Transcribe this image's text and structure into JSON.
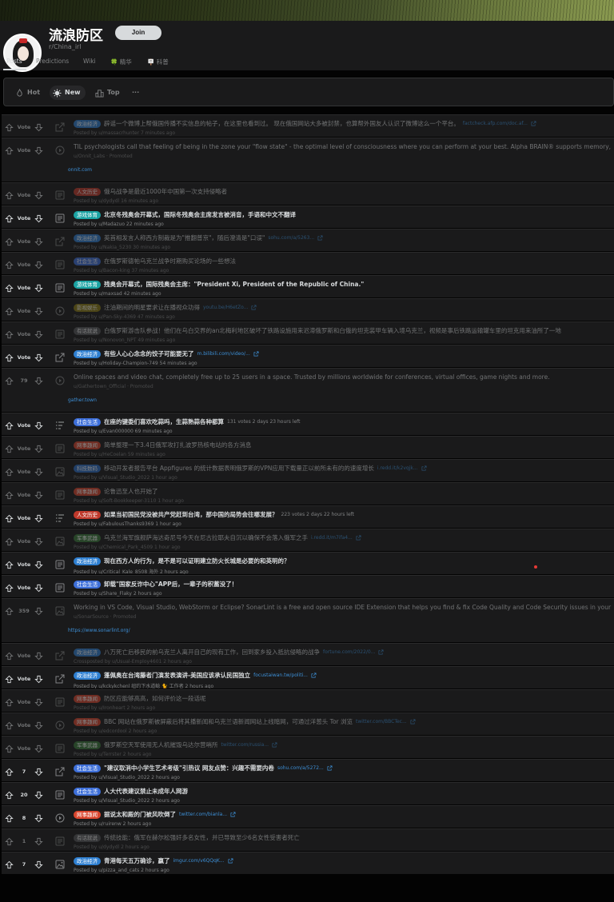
{
  "subreddit": {
    "title": "流浪防区",
    "name": "r/China_irl",
    "join_label": "Join"
  },
  "nav": [
    {
      "label": "Posts",
      "active": true
    },
    {
      "label": "Predictions",
      "active": false
    },
    {
      "label": "Wiki",
      "active": false
    },
    {
      "label": "🍀 精华",
      "active": false
    },
    {
      "label": "🪧 科普",
      "active": false
    }
  ],
  "sort": {
    "hot_label": "Hot",
    "new_label": "New",
    "top_label": "Top",
    "more_label": "···"
  },
  "colors": {
    "政治经济": "#2e7fd1",
    "人文历史": "#c0392b",
    "游戏体育": "#1aa3a3",
    "社会生活": "#3d6fd9",
    "影视娱乐": "#8a7a14",
    "有话就说": "#555759",
    "网事趣闻": "#d9462e",
    "科技数码": "#2a6cc4",
    "军事武器": "#3a7a3a"
  },
  "posts": [
    {
      "score": "Vote",
      "kind": "link",
      "flair": "政治经济",
      "title": "辟谣一个微博上帮俄国传播不实信息的帖子，在这里也看到过。 现在俄国网站大多被封禁，也算帮外国友人认识了微博这么一个平台。",
      "link": "factcheck.afp.com/doc.af...",
      "meta": "Posted by u/massacrhunter 7 minutes ago",
      "dim": true
    },
    {
      "score": "Vote",
      "kind": "video",
      "flair": "",
      "title": "TIL psychologists call that feeling of being in the zone your \"flow state\" - the optimal level of consciousness where you can perform at your best. Alpha BRAIN® supports memory,",
      "link": "",
      "meta": "u/Onnit_Labs · Promoted",
      "dim": true,
      "ad": "onnit.com"
    },
    {
      "score": "Vote",
      "kind": "text",
      "flair": "人文历史",
      "title": "俄乌战争是最近1000年中国第一次支持侵略者",
      "link": "",
      "meta": "Posted by u/dydydl 16 minutes ago",
      "dim": true
    },
    {
      "score": "Vote",
      "kind": "text",
      "flair": "游戏体育",
      "title": "北京冬残奥会开幕式，国际冬残奥会主席发言被消音，手语和中文不翻译",
      "link": "",
      "meta": "Posted by u/Madazuo 22 minutes ago",
      "dim": false
    },
    {
      "score": "Vote",
      "kind": "link",
      "flair": "政治经济",
      "title": "英首相发言人称西方制裁是为\"推翻普京\"，随后澄清是\"口误\"",
      "link": "sohu.com/a/5263...",
      "meta": "Posted by u/Nakia_5230 30 minutes ago",
      "dim": true
    },
    {
      "score": "Vote",
      "kind": "text",
      "flair": "社会生活",
      "title": "在俄罗斯德帕乌克兰战争时期购买论场的一些想法",
      "link": "",
      "meta": "Posted by u/Bacon-king 37 minutes ago",
      "dim": true
    },
    {
      "score": "Vote",
      "kind": "text",
      "flair": "游戏体育",
      "title": "残奥会开幕式，国际残奥会主席：\"President Xi, President of the Republic of China.\"",
      "link": "",
      "meta": "Posted by u/maxsad 42 minutes ago",
      "dim": false
    },
    {
      "score": "Vote",
      "kind": "video",
      "flair": "影视娱乐",
      "title": "注油期间的明星要求让在播视众功得",
      "link": "youtu.be/H6etZo...",
      "meta": "Posted by u/Pan-Sky-4369 47 minutes ago",
      "dim": true
    },
    {
      "score": "Vote",
      "kind": "text",
      "flair": "有话就说",
      "title": "白俄罗斯游击队参战！他们在乌白交界的an北梅利地区破坏了铁路设施用来迟滞俄罗斯和白俄的坦克装甲车辆入境乌克兰，视频是事后铁路运输罐车里的坦克用来油所了一地",
      "link": "",
      "meta": "Posted by u/Nonovon_NPT 49 minutes ago",
      "dim": true
    },
    {
      "score": "Vote",
      "kind": "link",
      "flair": "政治经济",
      "title": "有些人心心念念的饺子可能要无了",
      "link": "m.bilibili.com/video/...",
      "meta": "Posted by u/Holiday-Champion-749 54 minutes ago",
      "dim": false
    },
    {
      "score": "79",
      "kind": "video",
      "flair": "",
      "title": "Online spaces and video chat, completely free up to 25 users in a space. Trusted by millions worldwide for conferences, virtual offices, game nights and more.",
      "link": "",
      "meta": "u/Gathertown_Official · Promoted",
      "dim": true,
      "ad": "gather.town"
    },
    {
      "score": "Vote",
      "kind": "poll",
      "flair": "社会生活",
      "title": "在座的键委们喜欢吃蒜吗，生蒜熟蒜各种都算",
      "link": "",
      "poll": "131 votes 2 days 23 hours left",
      "meta": "Posted by u/Evan000000 69 minutes ago",
      "dim": false
    },
    {
      "score": "Vote",
      "kind": "text",
      "flair": "网事趣闻",
      "title": "简单整理一下3.4日俄军攻打扎波罗热核电站的各方消息",
      "link": "",
      "meta": "Posted by u/HeCoelan 59 minutes ago",
      "dim": true
    },
    {
      "score": "Vote",
      "kind": "image",
      "flair": "科技数码",
      "title": "移动开发者报告平台 Appfigures 的统计数据表明俄罗斯的VPN应用下载量正以前所未有的的速度增长",
      "link": "i.redd.it/k2vqjk...",
      "meta": "Posted by u/Visual_Studio_2022 1 hour ago",
      "dim": true
    },
    {
      "score": "Vote",
      "kind": "text",
      "flair": "网事趣闻",
      "title": "论鲁迅至人也开始了",
      "link": "",
      "meta": "Posted by u/Soft-Bookkeeper-3110 1 hour ago",
      "dim": true
    },
    {
      "score": "Vote",
      "kind": "poll",
      "flair": "人文历史",
      "title": "如果当初国民党没被共产党赶到台湾，那中国的局势会往哪发展？",
      "link": "",
      "poll": "223 votes 2 days 22 hours left",
      "meta": "Posted by u/FabulousThanks9369 1 hour ago",
      "dim": false
    },
    {
      "score": "Vote",
      "kind": "image",
      "flair": "军事武器",
      "title": "乌克兰海军旗舰萨海达奇尼号今天在尼古拉耶夫自沉以确保不会落入俄军之手",
      "link": "i.redd.it/m7ifa4...",
      "meta": "Posted by u/Chemical_Park_4509 1 hour ago",
      "dim": true
    },
    {
      "score": "Vote",
      "kind": "text",
      "flair": "政治经济",
      "title": "现在西方人的行为，是不是可以证明建立防火长城是必要的和英明的？",
      "link": "",
      "meta": "Posted by u/Critical_Kale_8508 海外 2 hours ago",
      "dim": false
    },
    {
      "score": "Vote",
      "kind": "text",
      "flair": "社会生活",
      "title": "卸载\"国家反诈中心\"APP后，一辈子的积蓄没了！",
      "link": "",
      "meta": "Posted by u/Share_Flaky 2 hours ago",
      "dim": false
    },
    {
      "score": "359",
      "kind": "image",
      "flair": "",
      "title": "Working in VS Code, Visual Studio, WebStorm or Eclipse? SonarLint is a free and open source IDE Extension that helps you find & fix Code Quality and Code Security issues in your",
      "link": "",
      "meta": "u/SonarSource · Promoted",
      "dim": true,
      "ad": "https://www.sonarlint.org/"
    },
    {
      "score": "Vote",
      "kind": "link",
      "flair": "政治经济",
      "title": "八万死亡后移民的前乌克兰人离开自己的现有工作，回到家乡投入抵抗侵略的战争",
      "link": "fortune.com/2022/0...",
      "meta": "Crossposted by u/Usual-Employ4601 2 hours ago",
      "dim": true
    },
    {
      "score": "Vote",
      "kind": "link",
      "flair": "政治经济",
      "title": "蓬佩奥在台湾藤者门演发表演讲-美国应该承认民国独立",
      "link": "focustaiwan.tw/politi...",
      "meta": "Posted by u/kckykchenl 纽约下水道鲶 🐈 工作者 2 hours ago",
      "dim": false
    },
    {
      "score": "Vote",
      "kind": "text",
      "flair": "网事趣闻",
      "title": "防区应能够高高，如何评价这一段话呢",
      "link": "",
      "meta": "Posted by u/Ironheart 2 hours ago",
      "dim": true
    },
    {
      "score": "Vote",
      "kind": "video",
      "flair": "网事趣闻",
      "title": "BBC 网站在俄罗斯被屏蔽后将其播新闻和乌克兰语新闻网站上线暗网，可通过洋葱头 Tor 浏览",
      "link": "twitter.com/BBCTec...",
      "meta": "Posted by u/edcordool 2 hours ago",
      "dim": true
    },
    {
      "score": "Vote",
      "kind": "text",
      "flair": "军事武器",
      "title": "俄罗斯空天军使用无人机摧毁乌达尔营哨所",
      "link": "twitter.com/russia...",
      "meta": "Posted by u/Terrster 2 hours ago",
      "dim": true
    },
    {
      "score": "7",
      "kind": "link",
      "flair": "社会生活",
      "title": "\"建议取消中小学生艺术考级\"引热议 网友点赞：兴趣不需要内卷",
      "link": "sohu.com/a/5272...",
      "meta": "Posted by u/Visual_Studio_2022 2 hours ago",
      "dim": false
    },
    {
      "score": "20",
      "kind": "text",
      "flair": "社会生活",
      "title": "人大代表建议禁止未成年人网游",
      "link": "",
      "meta": "Posted by u/Visual_Studio_2022 2 hours ago",
      "dim": false
    },
    {
      "score": "8",
      "kind": "video",
      "flair": "网事趣闻",
      "title": "据说太和殿的门被风吹倒了",
      "link": "twitter.com/bianla...",
      "meta": "Posted by u/ruirenw 2 hours ago",
      "dim": false
    },
    {
      "score": "1",
      "kind": "text",
      "flair": "有话就说",
      "title": "传统技能：俄军在赫尔松强奸多名女性，并已导致至少6名女性受害者死亡",
      "link": "",
      "meta": "Posted by u/dydydl 2 hours ago",
      "dim": true
    },
    {
      "score": "7",
      "kind": "image",
      "flair": "政治经济",
      "title": "青港每天五万确诊，赢了",
      "link": "imgur.com/v6QQqK...",
      "meta": "Posted by u/pizza_and_cats 2 hours ago",
      "dim": false
    }
  ]
}
